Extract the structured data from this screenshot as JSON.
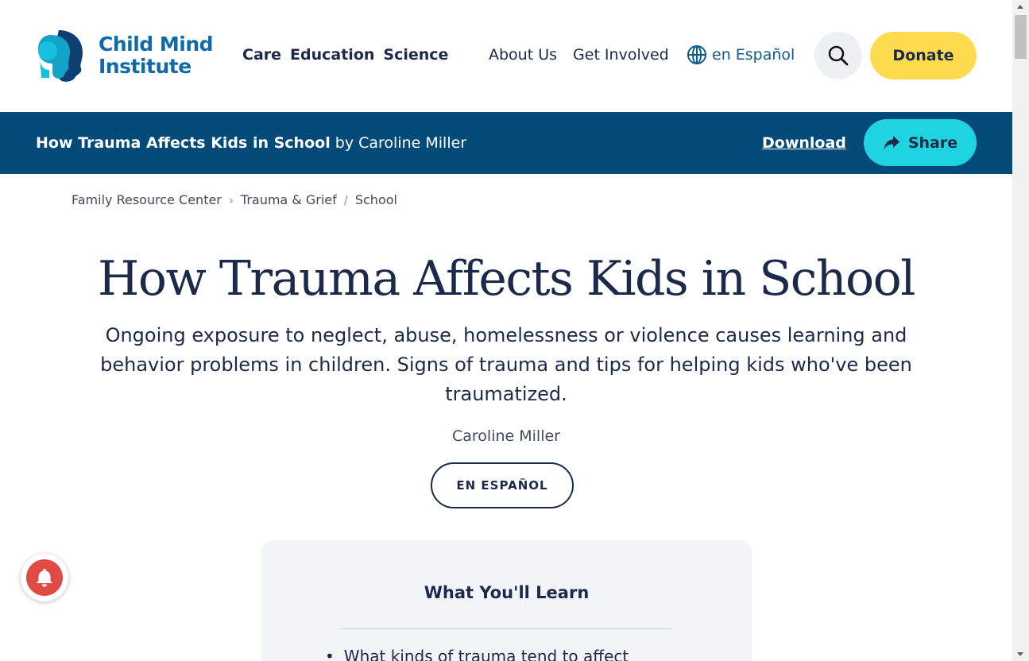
{
  "header": {
    "logo_line1": "Child Mind",
    "logo_line2": "Institute",
    "nav_primary": [
      "Care",
      "Education",
      "Science"
    ],
    "nav_secondary": [
      "About Us",
      "Get Involved"
    ],
    "lang_label": "en Español",
    "donate_label": "Donate",
    "brand_color": "#0e6aa8",
    "donate_color": "#fddb4e"
  },
  "article_bar": {
    "title": "How Trauma Affects Kids in School",
    "by_text": "by Caroline Miller",
    "download_label": "Download",
    "share_label": "Share",
    "bar_color": "#044a79",
    "share_color": "#1fd3e1"
  },
  "breadcrumb": {
    "items": [
      "Family Resource Center",
      "Trauma & Grief",
      "School"
    ],
    "separators": [
      "›",
      "/"
    ]
  },
  "hero": {
    "title": "How Trauma Affects Kids in School",
    "subtitle": "Ongoing exposure to neglect, abuse, homelessness or violence causes learning and behavior problems in children. Signs of trauma and tips for helping kids who've been traumatized.",
    "author": "Caroline Miller",
    "espanol_label": "EN ESPAÑOL"
  },
  "learn_box": {
    "title": "What You'll Learn",
    "items": [
      "What kinds of trauma tend to affect"
    ]
  },
  "icons": {
    "logo": "child-mind-logo-heads",
    "globe": "globe-icon",
    "search": "search-icon",
    "share": "share-arrow-icon",
    "bell": "bell-icon"
  }
}
